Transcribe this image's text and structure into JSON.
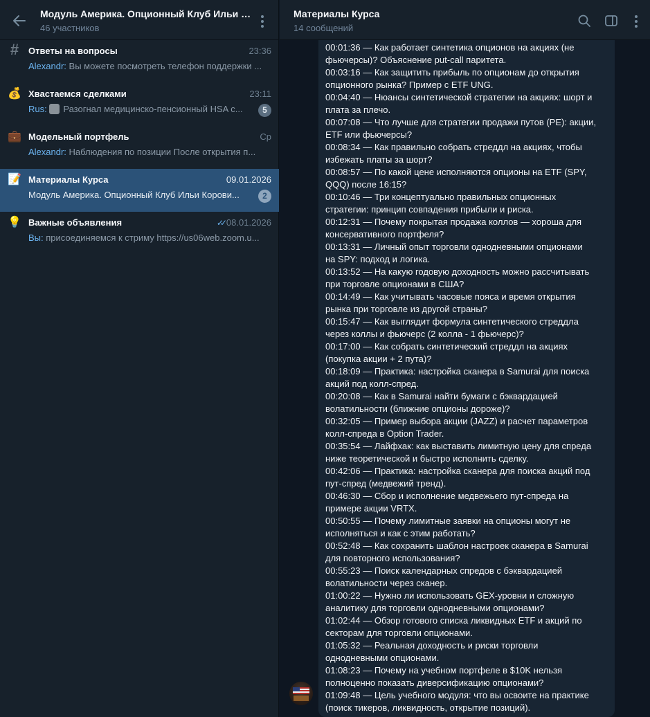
{
  "left_header": {
    "title": "Модуль Америка. Опционный Клуб Ильи Ко...",
    "subtitle": "46 участников"
  },
  "chats": [
    {
      "icon": "hash-icon",
      "glyph": "#",
      "name": "Ответы на вопросы",
      "time": "23:36",
      "sender": "Alexandr:",
      "preview": " Вы можете посмотреть телефон поддержки ..."
    },
    {
      "icon": "money-bag-icon",
      "glyph": "💰",
      "name": "Хвастаемся сделками",
      "time": "23:11",
      "sender": "Rus:",
      "preview": "Разогнал медицинско-пенсионный HSA с...",
      "badge": "5"
    },
    {
      "icon": "briefcase-icon",
      "glyph": "💼",
      "name": "Модельный портфель",
      "time": "Ср",
      "sender": "Alexandr:",
      "preview": " Наблюдения по позиции  После открытия п..."
    },
    {
      "icon": "memo-icon",
      "glyph": "📝",
      "name": "Материалы Курса",
      "time": "09.01.2026",
      "sender": "",
      "preview": "Модуль Америка. Опционный Клуб Ильи Корови...",
      "badge": "2"
    },
    {
      "icon": "lightbulb-icon",
      "glyph": "💡",
      "name": "Важные объявления",
      "time": "08.01.2026",
      "sender": "Вы:",
      "preview": " присоединяемся к стриму https://us06web.zoom.u..."
    }
  ],
  "right_header": {
    "title": "Материалы Курса",
    "subtitle": "14 сообщений"
  },
  "message_lines": [
    "00:01:36 — Как работает синтетика опционов на акциях (не",
    "фьючерсы)? Объяснение put-call паритета.",
    "00:03:16 — Как защитить прибыль по опционам до открытия",
    "опционного рынка? Пример с ETF UNG.",
    "00:04:40 — Нюансы синтетической стратегии на акциях: шорт и",
    "плата за плечо.",
    "00:07:08 — Что лучше для стратегии продажи путов (PE): акции,",
    "ETF или фьючерсы?",
    "00:08:34 — Как правильно собрать стреддл на акциях, чтобы",
    "избежать платы за шорт?",
    "00:08:57 — По какой цене исполняются опционы на ETF (SPY,",
    "QQQ) после 16:15?",
    "00:10:46 — Три концептуально правильных опционных",
    "стратегии: принцип совпадения прибыли и риска.",
    "00:12:31 — Почему покрытая продажа коллов — хороша для",
    "консервативного портфеля?",
    "00:13:31 — Личный опыт торговли однодневными опционами",
    "на SPY: подход и логика.",
    "00:13:52 — На какую годовую доходность можно рассчитывать",
    "при торговле опционами в США?",
    "00:14:49 — Как учитывать часовые пояса и время открытия",
    "рынка при торговле из другой страны?",
    "00:15:47 — Как выглядит формула синтетического стреддла",
    "через коллы и фьючерс (2 колла - 1 фьючерс)?",
    "00:17:00 — Как собрать синтетический стреддл на акциях",
    "(покупка акции + 2 пута)?",
    "00:18:09 — Практика: настройка сканера в Samurai для поиска",
    "акций под колл-спред.",
    "00:20:08 — Как в Samurai найти бумаги с бэквардацией",
    "волатильности (ближние опционы дороже)?",
    "00:32:05 — Пример выбора акции (JAZZ) и расчет параметров",
    "колл-спреда в Option Trader.",
    "00:35:54 — Лайфхак: как выставить лимитную цену для спреда",
    "ниже теоретической и быстро исполнить сделку.",
    "00:42:06 — Практика: настройка сканера для поиска акций под",
    "пут-спред (медвежий тренд).",
    "00:46:30 — Сбор и исполнение медвежьего пут-спреда на",
    "примере акции VRTX.",
    "00:50:55 — Почему лимитные заявки на опционы могут не",
    "исполняться и как с этим работать?",
    "00:52:48 — Как сохранить шаблон настроек сканера в Samurai",
    "для повторного использования?",
    "00:55:23 — Поиск календарных спредов с бэквардацией",
    "волатильности через сканер.",
    "01:00:22 — Нужно ли использовать GEX-уровни и сложную",
    "аналитику для торговли однодневными опционами?",
    "01:02:44 — Обзор готового списка ликвидных ETF и акций по",
    "секторам для торговли опционами.",
    "01:05:32 — Реальная доходность и риски торговли",
    "однодневными опционами.",
    "01:08:23 — Почему на учебном портфеле в $10K нельзя",
    "полноценно показать диверсификацию опционами?",
    "01:09:48 — Цель учебного модуля: что вы освоите на практике",
    "(поиск тикеров, ликвидность, открытие позиций)."
  ]
}
